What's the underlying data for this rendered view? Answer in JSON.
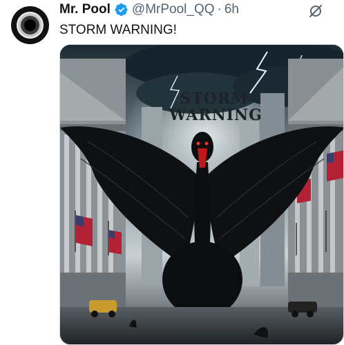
{
  "author": {
    "name": "Mr. Pool",
    "handle": "@MrPool_QQ",
    "separator": "·",
    "time": "6h",
    "verified": true
  },
  "tweet": {
    "text": "STORM WARNING!"
  },
  "image": {
    "sign_lines": [
      "STORM",
      "WARNING"
    ]
  },
  "icons": {
    "verified": "verified-badge-icon",
    "grok": "grok-icon"
  },
  "colors": {
    "verified_blue": "#1d9bf0",
    "secondary_text": "#536471"
  }
}
